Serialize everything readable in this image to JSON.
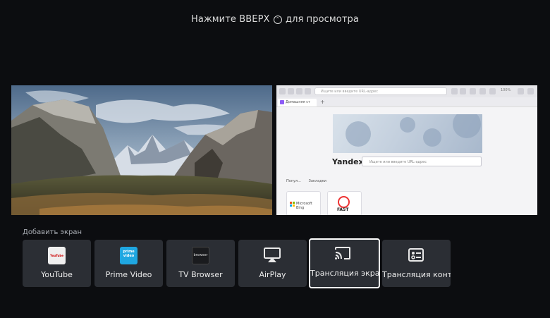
{
  "hint": {
    "before": "Нажмите ВВЕРХ",
    "after": "для просмотра"
  },
  "browser_preview": {
    "url_placeholder": "Ищите или введите URL-адрес",
    "zoom": "100%",
    "tab_label": "Домашняя ст",
    "logo": "Yandex",
    "search_placeholder": "Ищите или введите URL-адрес",
    "links": [
      "Попул...",
      "Закладки"
    ],
    "tiles": [
      "Microsoft Bing",
      "FAST"
    ]
  },
  "add_screen_label": "Добавить экран",
  "cards": [
    {
      "title": "YouTube",
      "icon": "youtube-icon",
      "icon_text": "YouTube"
    },
    {
      "title": "Prime Video",
      "icon": "prime-video-icon",
      "icon_text": "prime video"
    },
    {
      "title": "TV Browser",
      "icon": "browser-icon",
      "icon_text": "browser"
    },
    {
      "title": "AirPlay",
      "icon": "airplay-icon"
    },
    {
      "title": "Трансляция экра",
      "icon": "cast-icon",
      "selected": true
    },
    {
      "title": "Трансляция конт…",
      "icon": "content-cast-icon"
    }
  ],
  "colors": {
    "background": "#0c0d10",
    "card": "#2b2e34",
    "selected_border": "#ffffff"
  }
}
